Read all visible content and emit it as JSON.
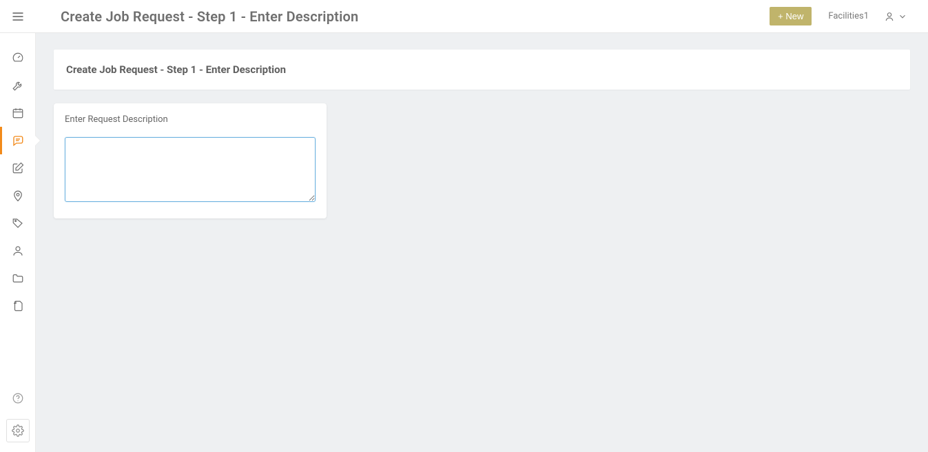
{
  "header": {
    "title": "Create Job Request - Step 1 - Enter Description",
    "new_button": "+ New",
    "user": "Facilities1"
  },
  "sidebar": {
    "items": [
      {
        "name": "dashboard"
      },
      {
        "name": "maintenance"
      },
      {
        "name": "calendar"
      },
      {
        "name": "requests",
        "active": true
      },
      {
        "name": "compose"
      },
      {
        "name": "locations"
      },
      {
        "name": "assets"
      },
      {
        "name": "people"
      },
      {
        "name": "files"
      },
      {
        "name": "documents"
      }
    ]
  },
  "main": {
    "panel_title": "Create Job Request - Step 1 - Enter Description",
    "field_label": "Enter Request Description",
    "description_value": ""
  }
}
